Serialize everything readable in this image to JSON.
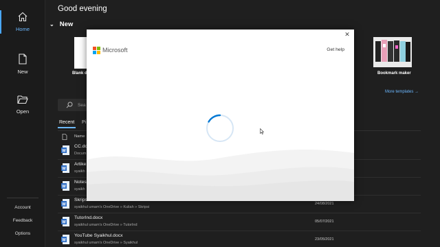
{
  "nav": {
    "home": "Home",
    "new": "New",
    "open": "Open",
    "account": "Account",
    "feedback": "Feedback",
    "options": "Options"
  },
  "main": {
    "greeting": "Good evening",
    "new_section": "New",
    "templates": [
      {
        "label": "Blank do"
      },
      {
        "label": "Bookmark maker"
      }
    ],
    "more_templates": "More templates",
    "search_placeholder": "Sea",
    "tabs": {
      "recent": "Recent",
      "pinned": "Pi"
    },
    "column_name": "Name",
    "files": [
      {
        "name": "CC.docx",
        "path": "Docum",
        "date": ""
      },
      {
        "name": "Artike",
        "path": "syaikh",
        "date": ""
      },
      {
        "name": "Notes",
        "path": "syaikh",
        "date": ""
      },
      {
        "name": "Skripsi.docx",
        "path": "syaikhul umam's OneDrive » Kuliah » Skripsi",
        "date": "24/08/2021"
      },
      {
        "name": "TutorInd.docx",
        "path": "syaikhul umam's OneDrive » TutorInd",
        "date": "05/07/2021"
      },
      {
        "name": "YouTube Syaikhul.docx",
        "path": "syaikhul umam's OneDrive » Syaikhul",
        "date": "23/05/2021"
      }
    ]
  },
  "dialog": {
    "brand": "Microsoft",
    "get_help": "Get help",
    "close_glyph": "✕",
    "logo_colors": [
      "#f25022",
      "#7fba00",
      "#00a4ef",
      "#ffb900"
    ],
    "accent": "#0078d4"
  }
}
